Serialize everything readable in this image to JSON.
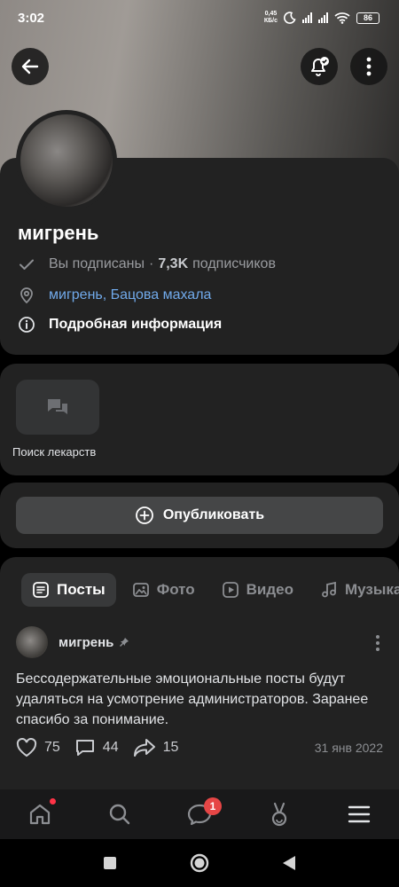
{
  "status_bar": {
    "time": "3:02",
    "net_speed_value": "0,45",
    "net_speed_unit": "КБ/с",
    "battery": "86",
    "icons": [
      "moon-icon",
      "signal-icon",
      "signal-icon",
      "wifi-icon",
      "battery-icon"
    ]
  },
  "header": {
    "back_icon": "arrow-left-icon",
    "subscribe_bell_icon": "bell-check-icon",
    "menu_icon": "more-vertical-icon"
  },
  "profile": {
    "name": "мигрень",
    "subscribed_label": "Вы подписаны",
    "separator": "·",
    "subscribers_count": "7,3K",
    "subscribers_label": "подписчиков",
    "location": "мигрень, Бацова махала",
    "details_label": "Подробная информация"
  },
  "shortcuts": {
    "items": [
      {
        "label": "Поиск лекарств",
        "icon": "chat-bubbles-icon"
      }
    ]
  },
  "publish": {
    "label": "Опубликовать",
    "icon": "plus-circle-icon"
  },
  "tabs": [
    {
      "label": "Посты",
      "icon": "posts-icon",
      "active": true
    },
    {
      "label": "Фото",
      "icon": "photo-icon",
      "active": false
    },
    {
      "label": "Видео",
      "icon": "video-icon",
      "active": false
    },
    {
      "label": "Музыка",
      "icon": "music-icon",
      "active": false
    }
  ],
  "post": {
    "author": "мигрень",
    "pinned_icon": "pin-icon",
    "text": "Бессодержательные эмоциональные посты будут удаляться на усмотрение администраторов. Заранее спасибо за понимание.",
    "likes": "75",
    "comments": "44",
    "shares": "15",
    "date": "31 янв 2022"
  },
  "bottom_nav": {
    "items": [
      {
        "name": "home-icon",
        "dot": true
      },
      {
        "name": "search-icon"
      },
      {
        "name": "messages-icon",
        "badge": "1"
      },
      {
        "name": "clips-icon"
      },
      {
        "name": "menu-icon"
      }
    ]
  },
  "colors": {
    "accent_link": "#71aaeb",
    "card_bg": "#222222",
    "badge": "#e64646"
  }
}
